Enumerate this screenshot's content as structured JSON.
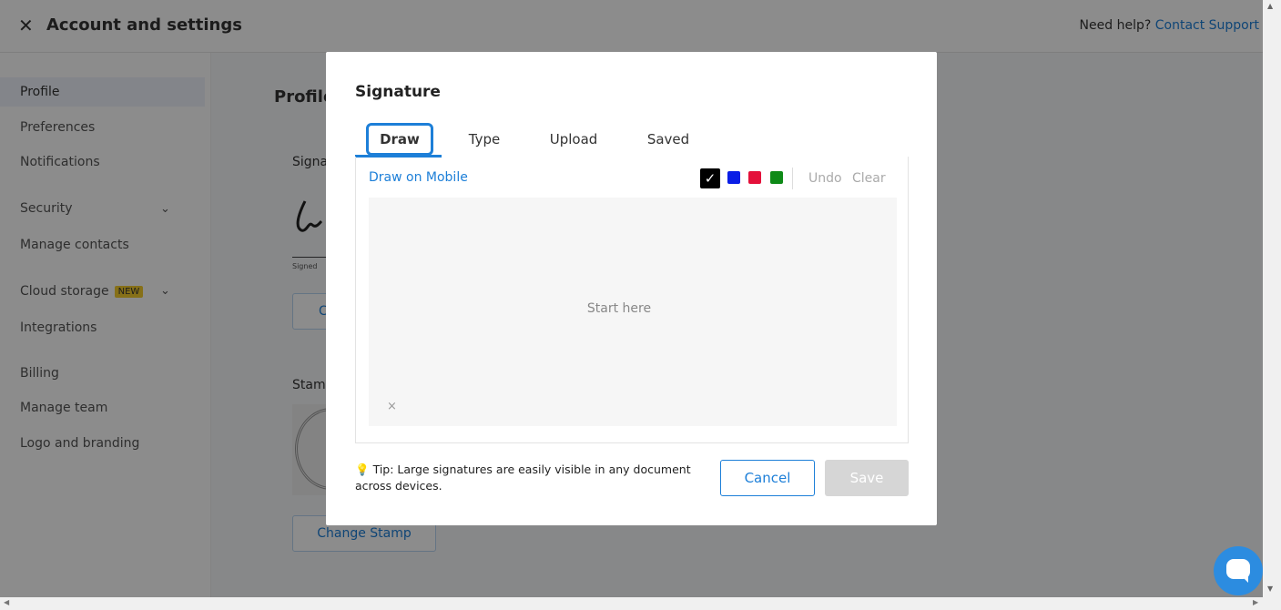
{
  "header": {
    "title": "Account and settings",
    "help_text": "Need help?",
    "help_link": "Contact Support"
  },
  "sidebar": {
    "items": [
      {
        "label": "Profile"
      },
      {
        "label": "Preferences"
      },
      {
        "label": "Notifications"
      },
      {
        "label": "Security"
      },
      {
        "label": "Manage contacts"
      },
      {
        "label": "Cloud storage",
        "badge": "NEW"
      },
      {
        "label": "Integrations"
      },
      {
        "label": "Billing"
      },
      {
        "label": "Manage team"
      },
      {
        "label": "Logo and branding"
      }
    ]
  },
  "main": {
    "title": "Profile",
    "signature_label": "Signa",
    "signature_caption": "Signed",
    "change_signature_label": "C",
    "stamp_label": "Stam",
    "change_stamp_label": "Change Stamp"
  },
  "modal": {
    "title": "Signature",
    "tabs": [
      {
        "label": "Draw",
        "active": true
      },
      {
        "label": "Type"
      },
      {
        "label": "Upload"
      },
      {
        "label": "Saved"
      }
    ],
    "draw_on_mobile": "Draw on Mobile",
    "colors": [
      "#000000",
      "#0a1ee6",
      "#e4103a",
      "#0e8a17"
    ],
    "selected_color": "#000000",
    "undo": "Undo",
    "clear": "Clear",
    "canvas_placeholder": "Start here",
    "canvas_clear_glyph": "×",
    "tip": "Tip: Large signatures are easily visible in any document across devices.",
    "cancel": "Cancel",
    "save": "Save"
  },
  "accent_color": "#1d7fd8"
}
